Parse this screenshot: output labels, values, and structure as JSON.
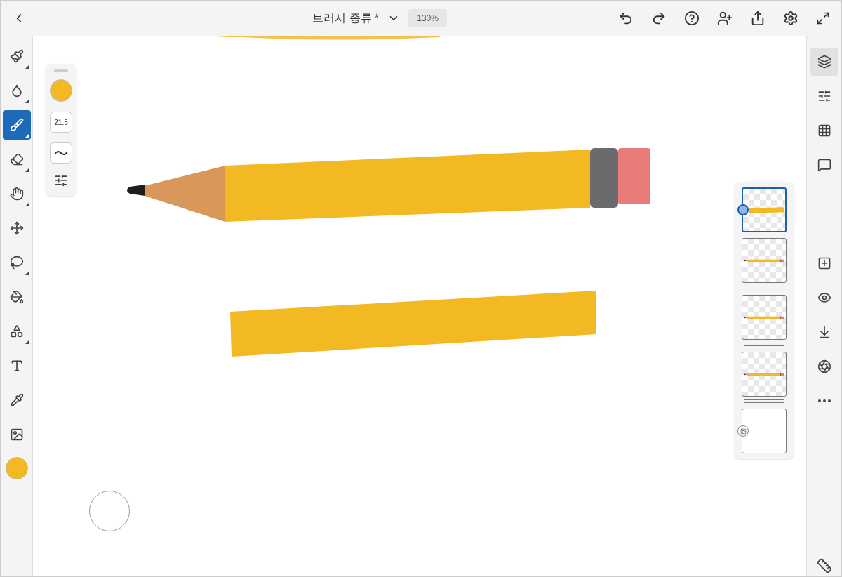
{
  "top_bar": {
    "title": "브러시 종류 *",
    "zoom": "130%"
  },
  "tools": [
    {
      "kind": "pixel-brush",
      "selected": false,
      "submenu": true
    },
    {
      "kind": "watercolor",
      "selected": false,
      "submenu": true
    },
    {
      "kind": "oil-brush",
      "selected": true,
      "submenu": true
    },
    {
      "kind": "eraser",
      "selected": false,
      "submenu": true
    },
    {
      "kind": "smudge",
      "selected": false,
      "submenu": true
    },
    {
      "kind": "move",
      "selected": false,
      "submenu": false
    },
    {
      "kind": "lasso",
      "selected": false,
      "submenu": true
    },
    {
      "kind": "fill",
      "selected": false,
      "submenu": false
    },
    {
      "kind": "shape",
      "selected": false,
      "submenu": true
    },
    {
      "kind": "text",
      "selected": false,
      "submenu": false
    },
    {
      "kind": "eyedropper",
      "selected": false,
      "submenu": false
    },
    {
      "kind": "image",
      "selected": false,
      "submenu": false
    }
  ],
  "tool_swatch": {
    "color": "#f2b922"
  },
  "brush_panel": {
    "color": "#f2b922",
    "size": "21.5"
  },
  "right_rail": [
    {
      "kind": "layers",
      "selected": true
    },
    {
      "kind": "adjust",
      "selected": false
    },
    {
      "kind": "grid",
      "selected": false
    },
    {
      "kind": "comment",
      "selected": false
    },
    {
      "kind": "add-layer",
      "selected": false
    },
    {
      "kind": "visibility",
      "selected": false
    },
    {
      "kind": "merge",
      "selected": false
    },
    {
      "kind": "blend",
      "selected": false
    },
    {
      "kind": "more",
      "selected": false
    }
  ],
  "layers": [
    {
      "kind": "stroke",
      "selected": true
    },
    {
      "kind": "pencil",
      "selected": false
    },
    {
      "kind": "pencil",
      "selected": false
    },
    {
      "kind": "pencil",
      "selected": false
    },
    {
      "kind": "image",
      "selected": false
    }
  ]
}
